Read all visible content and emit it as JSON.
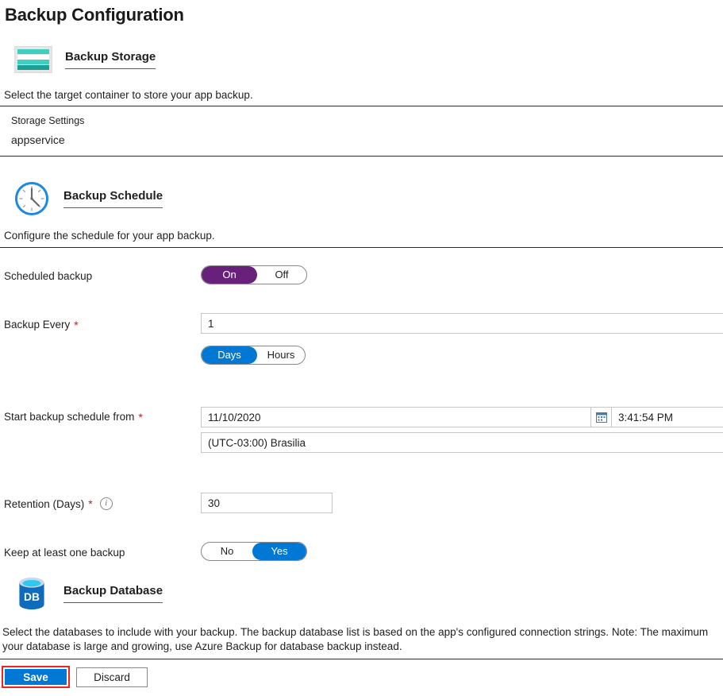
{
  "page": {
    "title": "Backup Configuration"
  },
  "storage_section": {
    "icon": "storage-stack-icon",
    "heading": "Backup Storage",
    "description": "Select the target container to store your app backup.",
    "settings_label": "Storage Settings",
    "settings_value": "appservice"
  },
  "schedule_section": {
    "icon": "clock-icon",
    "heading": "Backup Schedule",
    "description": "Configure the schedule for your app backup.",
    "scheduled_backup": {
      "label": "Scheduled backup",
      "options": [
        "On",
        "Off"
      ],
      "selected": "On",
      "selected_color": "#68217a"
    },
    "backup_every": {
      "label": "Backup Every",
      "required": "*",
      "value": "1",
      "unit_options": [
        "Days",
        "Hours"
      ],
      "unit_selected": "Days",
      "selected_color": "#0078d4"
    },
    "start_from": {
      "label": "Start backup schedule from",
      "required": "*",
      "date_value": "11/10/2020",
      "calendar_icon": "calendar-icon",
      "time_value": "3:41:54 PM",
      "timezone_value": "(UTC-03:00) Brasilia"
    },
    "retention": {
      "label": "Retention (Days)",
      "required": "*",
      "info_icon": "info-icon",
      "value": "30"
    },
    "keep_one": {
      "label": "Keep at least one backup",
      "options": [
        "No",
        "Yes"
      ],
      "selected": "Yes",
      "selected_color": "#0078d4"
    }
  },
  "database_section": {
    "icon": "database-icon",
    "icon_text": "DB",
    "heading": "Backup Database",
    "description_line1": "Select the databases to include with your backup. The backup database list is based on the app's configured connection strings. Note: The maximum",
    "description_line2": "your database is large and growing, use Azure Backup for database backup instead."
  },
  "footer": {
    "save_label": "Save",
    "discard_label": "Discard",
    "save_highlight_color": "#ee2222"
  }
}
